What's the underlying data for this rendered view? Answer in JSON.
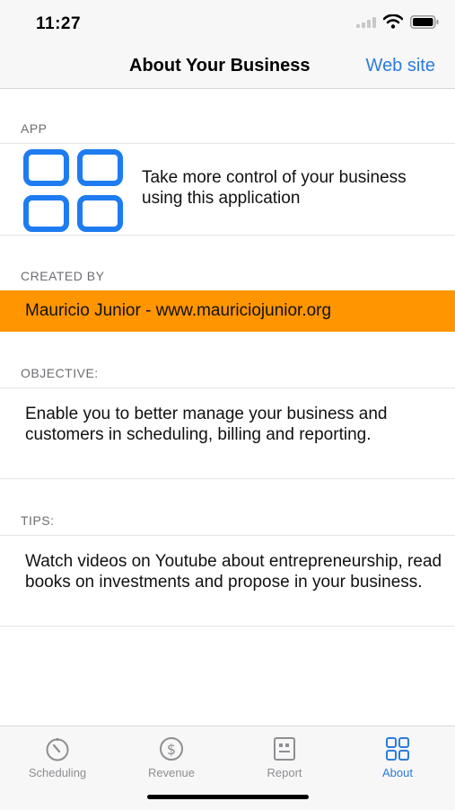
{
  "status": {
    "time": "11:27"
  },
  "nav": {
    "title": "About Your Business",
    "link": "Web site"
  },
  "sections": {
    "app": {
      "header": "APP",
      "description": "Take more control of your business using this application"
    },
    "created_by": {
      "header": "CREATED BY",
      "text": "Mauricio Junior - www.mauriciojunior.org"
    },
    "objective": {
      "header": "OBJECTIVE:",
      "text": "Enable you to better manage your business and customers in scheduling, billing and reporting."
    },
    "tips": {
      "header": "TIPS:",
      "text": "Watch videos on Youtube about entrepreneurship, read books on investments and propose in your business."
    }
  },
  "tabs": [
    {
      "label": "Scheduling",
      "icon": "stopwatch-icon",
      "active": false
    },
    {
      "label": "Revenue",
      "icon": "dollar-icon",
      "active": false
    },
    {
      "label": "Report",
      "icon": "report-icon",
      "active": false
    },
    {
      "label": "About",
      "icon": "grid-icon",
      "active": true
    }
  ],
  "colors": {
    "accent": "#2b7cdf",
    "highlight": "#ff9500",
    "inactive": "#8e8e93"
  }
}
